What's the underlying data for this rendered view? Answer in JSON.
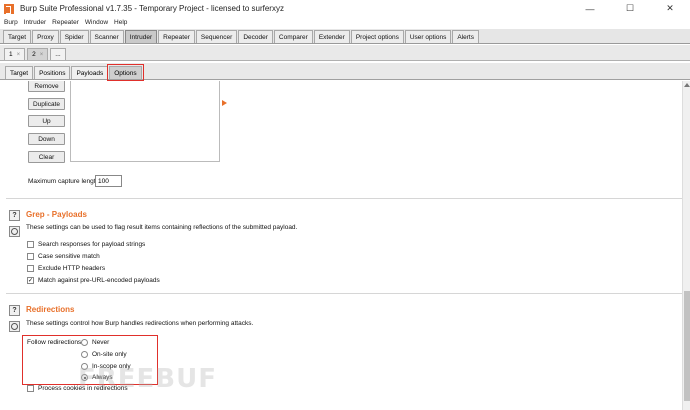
{
  "window": {
    "title": "Burp Suite Professional v1.7.35 - Temporary Project - licensed to surferxyz",
    "minimize": "—",
    "maximize": "☐",
    "close": "✕"
  },
  "menu": [
    "Burp",
    "Intruder",
    "Repeater",
    "Window",
    "Help"
  ],
  "main_tabs": [
    {
      "label": "Target"
    },
    {
      "label": "Proxy"
    },
    {
      "label": "Spider"
    },
    {
      "label": "Scanner"
    },
    {
      "label": "Intruder",
      "active": true
    },
    {
      "label": "Repeater"
    },
    {
      "label": "Sequencer"
    },
    {
      "label": "Decoder"
    },
    {
      "label": "Comparer"
    },
    {
      "label": "Extender"
    },
    {
      "label": "Project options"
    },
    {
      "label": "User options"
    },
    {
      "label": "Alerts"
    }
  ],
  "number_tabs": {
    "tab1": "1",
    "tab2": "2",
    "close": "×",
    "more": "..."
  },
  "inner_tabs": [
    "Target",
    "Positions",
    "Payloads",
    "Options"
  ],
  "list_buttons": {
    "remove": "Remove",
    "duplicate": "Duplicate",
    "up": "Up",
    "down": "Down",
    "clear": "Clear"
  },
  "capture": {
    "label": "Maximum capture length:",
    "value": "100"
  },
  "grep_payloads": {
    "title": "Grep - Payloads",
    "description": "These settings can be used to flag result items containing reflections of the submitted payload.",
    "options": [
      {
        "label": "Search responses for payload strings",
        "checked": false
      },
      {
        "label": "Case sensitive match",
        "checked": false
      },
      {
        "label": "Exclude HTTP headers",
        "checked": false
      },
      {
        "label": "Match against pre-URL-encoded payloads",
        "checked": true
      }
    ]
  },
  "redirections": {
    "title": "Redirections",
    "description": "These settings control how Burp handles redirections when performing attacks.",
    "follow_label": "Follow redirections:",
    "choices": [
      "Never",
      "On-site only",
      "In-scope only",
      "Always"
    ],
    "selected": "Always",
    "process_cookies": "Process cookies in redirections"
  },
  "icons": {
    "help": "?",
    "check": "✓"
  },
  "watermark": "FREEBUF",
  "colors": {
    "accent": "#e8702a",
    "highlight": "#e0302b"
  }
}
